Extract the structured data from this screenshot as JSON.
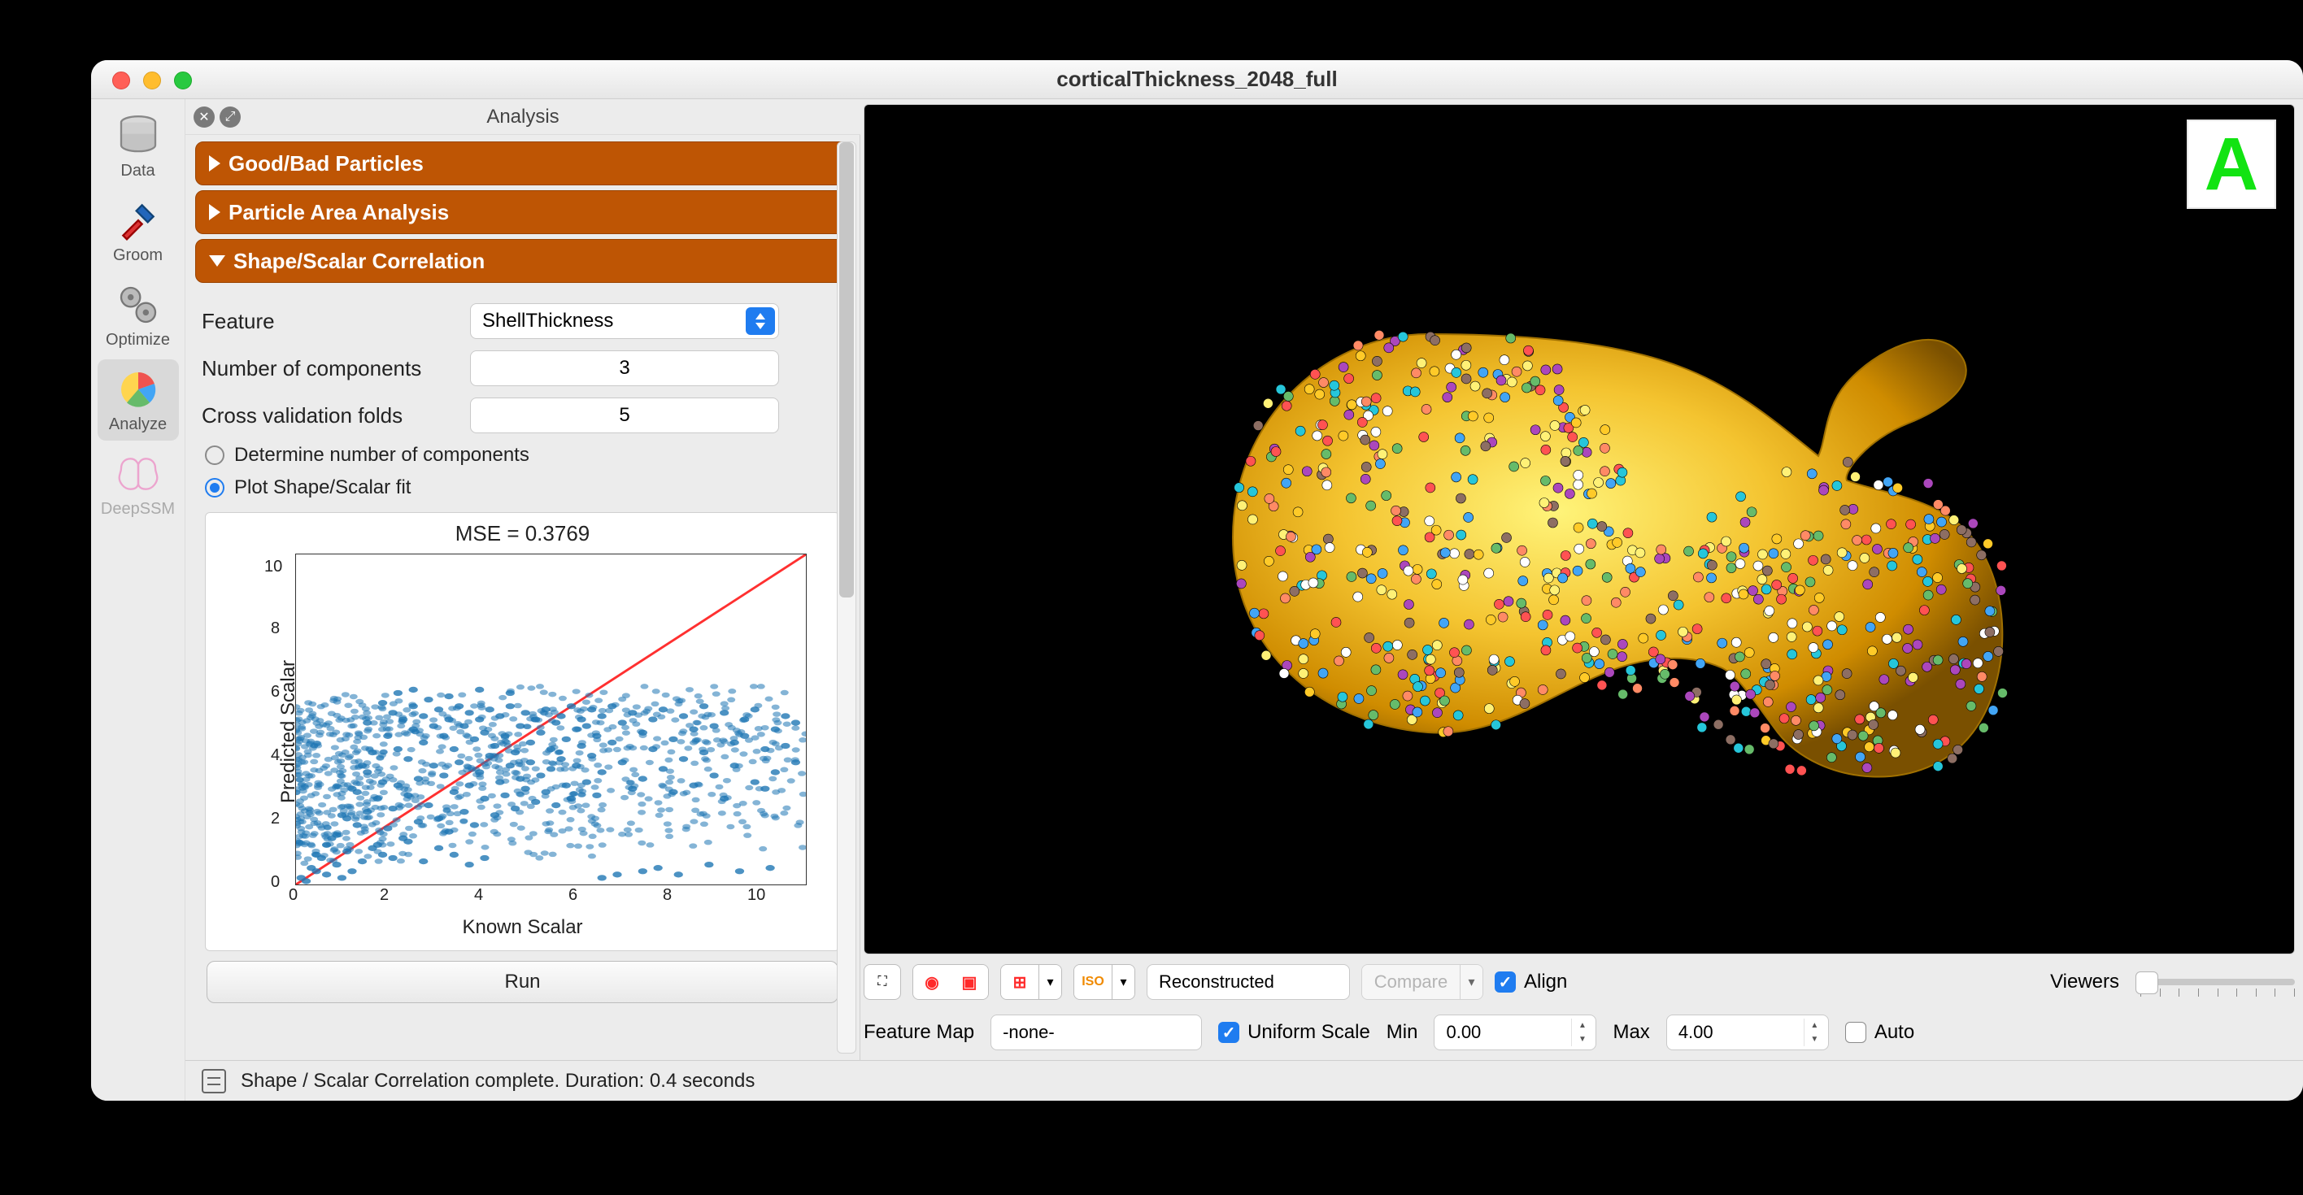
{
  "window": {
    "title": "corticalThickness_2048_full"
  },
  "rail": {
    "items": [
      {
        "id": "data",
        "label": "Data"
      },
      {
        "id": "groom",
        "label": "Groom"
      },
      {
        "id": "optimize",
        "label": "Optimize"
      },
      {
        "id": "analyze",
        "label": "Analyze"
      },
      {
        "id": "deepssm",
        "label": "DeepSSM"
      }
    ],
    "selected": "analyze"
  },
  "panel": {
    "title": "Analysis",
    "accordions": {
      "good_bad": "Good/Bad Particles",
      "area": "Particle Area Analysis",
      "correlation": "Shape/Scalar Correlation"
    }
  },
  "corr": {
    "feature_label": "Feature",
    "feature_value": "ShellThickness",
    "ncomp_label": "Number of components",
    "ncomp_value": "3",
    "cvfolds_label": "Cross validation folds",
    "cvfolds_value": "5",
    "radio_determine": "Determine number of components",
    "radio_plot": "Plot Shape/Scalar fit",
    "radio_selected": "plot",
    "run_label": "Run"
  },
  "chart_data": {
    "type": "scatter",
    "title": "MSE = 0.3769",
    "xlabel": "Known Scalar",
    "ylabel": "Predicted Scalar",
    "xlim": [
      0,
      10
    ],
    "ylim": [
      0,
      10
    ],
    "xticks": [
      0,
      2,
      4,
      6,
      8,
      10
    ],
    "yticks": [
      0,
      2,
      4,
      6,
      8,
      10
    ],
    "reference_line": {
      "x": [
        0,
        10
      ],
      "y": [
        0,
        10
      ],
      "color": "#ff3030"
    },
    "point_color": "#1f77b4",
    "note": "dense scatter; representative sampled points follow",
    "points": [
      [
        0.1,
        0.2
      ],
      [
        0.2,
        0.1
      ],
      [
        0.3,
        0.5
      ],
      [
        0.4,
        0.4
      ],
      [
        0.5,
        0.8
      ],
      [
        0.6,
        0.3
      ],
      [
        0.6,
        1.2
      ],
      [
        0.8,
        0.6
      ],
      [
        0.8,
        1.5
      ],
      [
        0.9,
        0.2
      ],
      [
        1.0,
        1.0
      ],
      [
        1.0,
        2.0
      ],
      [
        1.1,
        0.4
      ],
      [
        1.2,
        1.8
      ],
      [
        1.2,
        2.8
      ],
      [
        1.3,
        0.7
      ],
      [
        1.4,
        2.2
      ],
      [
        1.4,
        3.4
      ],
      [
        1.5,
        1.1
      ],
      [
        1.5,
        4.0
      ],
      [
        1.6,
        2.6
      ],
      [
        1.7,
        0.9
      ],
      [
        1.7,
        3.1
      ],
      [
        1.8,
        4.5
      ],
      [
        1.8,
        1.7
      ],
      [
        1.9,
        2.3
      ],
      [
        1.9,
        5.2
      ],
      [
        2.0,
        3.0
      ],
      [
        2.0,
        4.1
      ],
      [
        2.1,
        1.4
      ],
      [
        2.1,
        5.0
      ],
      [
        2.2,
        2.7
      ],
      [
        2.2,
        3.8
      ],
      [
        2.3,
        4.7
      ],
      [
        2.3,
        5.4
      ],
      [
        2.4,
        1.9
      ],
      [
        2.4,
        3.2
      ],
      [
        2.5,
        4.3
      ],
      [
        2.5,
        5.1
      ],
      [
        2.6,
        2.4
      ],
      [
        2.6,
        5.6
      ],
      [
        2.7,
        3.6
      ],
      [
        2.7,
        4.8
      ],
      [
        2.8,
        2.0
      ],
      [
        2.8,
        5.3
      ],
      [
        2.9,
        3.3
      ],
      [
        2.9,
        4.5
      ],
      [
        3.0,
        1.6
      ],
      [
        3.0,
        5.0
      ],
      [
        3.1,
        2.8
      ],
      [
        3.1,
        4.1
      ],
      [
        3.2,
        3.7
      ],
      [
        3.2,
        5.4
      ],
      [
        3.3,
        2.2
      ],
      [
        3.3,
        4.8
      ],
      [
        3.4,
        3.0
      ],
      [
        3.4,
        5.2
      ],
      [
        3.5,
        4.4
      ],
      [
        3.5,
        1.8
      ],
      [
        3.6,
        5.0
      ],
      [
        3.6,
        3.4
      ],
      [
        3.7,
        2.6
      ],
      [
        3.7,
        4.6
      ],
      [
        3.8,
        3.9
      ],
      [
        3.8,
        5.3
      ],
      [
        3.9,
        2.1
      ],
      [
        3.9,
        4.2
      ],
      [
        4.0,
        3.1
      ],
      [
        4.0,
        5.1
      ],
      [
        4.1,
        4.5
      ],
      [
        4.1,
        2.7
      ],
      [
        4.2,
        3.6
      ],
      [
        4.2,
        5.4
      ],
      [
        4.3,
        4.0
      ],
      [
        4.3,
        2.3
      ],
      [
        4.4,
        4.8
      ],
      [
        4.4,
        3.2
      ],
      [
        4.5,
        5.2
      ],
      [
        4.5,
        2.9
      ],
      [
        4.6,
        4.3
      ],
      [
        4.6,
        3.7
      ],
      [
        4.7,
        5.0
      ],
      [
        4.7,
        2.5
      ],
      [
        4.8,
        4.6
      ],
      [
        4.8,
        3.3
      ],
      [
        4.9,
        5.3
      ],
      [
        4.9,
        2.8
      ],
      [
        5.0,
        4.1
      ],
      [
        5.0,
        3.5
      ],
      [
        5.1,
        4.9
      ],
      [
        5.1,
        2.4
      ],
      [
        5.2,
        3.8
      ],
      [
        5.2,
        5.1
      ],
      [
        5.3,
        4.4
      ],
      [
        5.3,
        3.0
      ],
      [
        5.4,
        5.4
      ],
      [
        5.4,
        2.6
      ],
      [
        5.5,
        4.7
      ],
      [
        5.5,
        3.6
      ],
      [
        5.6,
        4.2
      ],
      [
        5.6,
        5.0
      ],
      [
        5.7,
        3.1
      ],
      [
        5.7,
        4.8
      ],
      [
        5.8,
        3.9
      ],
      [
        5.8,
        5.3
      ],
      [
        5.9,
        4.5
      ],
      [
        5.9,
        2.7
      ],
      [
        6.0,
        5.1
      ],
      [
        6.0,
        3.4
      ],
      [
        6.2,
        4.3
      ],
      [
        6.2,
        5.4
      ],
      [
        6.4,
        3.7
      ],
      [
        6.4,
        4.9
      ],
      [
        6.6,
        5.2
      ],
      [
        6.6,
        2.9
      ],
      [
        6.8,
        4.6
      ],
      [
        6.8,
        3.2
      ],
      [
        7.0,
        5.0
      ],
      [
        7.0,
        4.1
      ],
      [
        7.2,
        3.5
      ],
      [
        7.2,
        5.3
      ],
      [
        7.4,
        4.4
      ],
      [
        7.4,
        2.8
      ],
      [
        7.6,
        5.1
      ],
      [
        7.6,
        3.8
      ],
      [
        7.8,
        4.7
      ],
      [
        7.8,
        3.0
      ],
      [
        8.0,
        5.4
      ],
      [
        8.0,
        4.0
      ],
      [
        8.2,
        3.3
      ],
      [
        8.2,
        4.8
      ],
      [
        8.4,
        5.2
      ],
      [
        8.4,
        2.6
      ],
      [
        8.6,
        4.3
      ],
      [
        8.6,
        3.6
      ],
      [
        8.8,
        5.0
      ],
      [
        8.8,
        4.5
      ],
      [
        9.0,
        3.1
      ],
      [
        9.0,
        5.3
      ],
      [
        9.2,
        4.1
      ],
      [
        9.2,
        2.9
      ],
      [
        9.4,
        4.7
      ],
      [
        9.4,
        3.4
      ],
      [
        9.6,
        5.1
      ],
      [
        9.6,
        4.2
      ],
      [
        9.8,
        3.7
      ],
      [
        9.8,
        4.9
      ],
      [
        0.4,
        0.9
      ],
      [
        0.7,
        1.4
      ],
      [
        0.9,
        2.1
      ],
      [
        1.1,
        2.9
      ],
      [
        1.3,
        3.6
      ],
      [
        1.6,
        1.2
      ],
      [
        1.9,
        0.8
      ],
      [
        2.2,
        1.3
      ],
      [
        2.5,
        0.7
      ],
      [
        2.8,
        1.1
      ],
      [
        3.1,
        0.9
      ],
      [
        3.4,
        0.6
      ],
      [
        3.7,
        0.8
      ],
      [
        6.0,
        0.2
      ],
      [
        6.3,
        0.3
      ],
      [
        6.8,
        0.4
      ],
      [
        7.1,
        0.5
      ],
      [
        7.5,
        0.3
      ],
      [
        8.1,
        0.6
      ],
      [
        8.7,
        0.4
      ],
      [
        9.3,
        0.5
      ],
      [
        1.4,
        4.9
      ],
      [
        1.7,
        5.5
      ],
      [
        2.0,
        5.8
      ],
      [
        2.3,
        5.9
      ],
      [
        3.6,
        5.9
      ],
      [
        4.2,
        5.8
      ],
      [
        3.0,
        5.7
      ]
    ]
  },
  "viewer": {
    "corner_label": "A",
    "display_mode_value": "Reconstructed",
    "compare_label": "Compare",
    "align_label": "Align",
    "align_checked": true,
    "viewers_label": "Viewers"
  },
  "featuremap": {
    "label": "Feature Map",
    "value": "-none-",
    "uniform_label": "Uniform Scale",
    "uniform_checked": true,
    "min_label": "Min",
    "min_value": "0.00",
    "max_label": "Max",
    "max_value": "4.00",
    "auto_label": "Auto",
    "auto_checked": false
  },
  "status": {
    "text": "Shape / Scalar Correlation complete.  Duration: 0.4 seconds"
  }
}
